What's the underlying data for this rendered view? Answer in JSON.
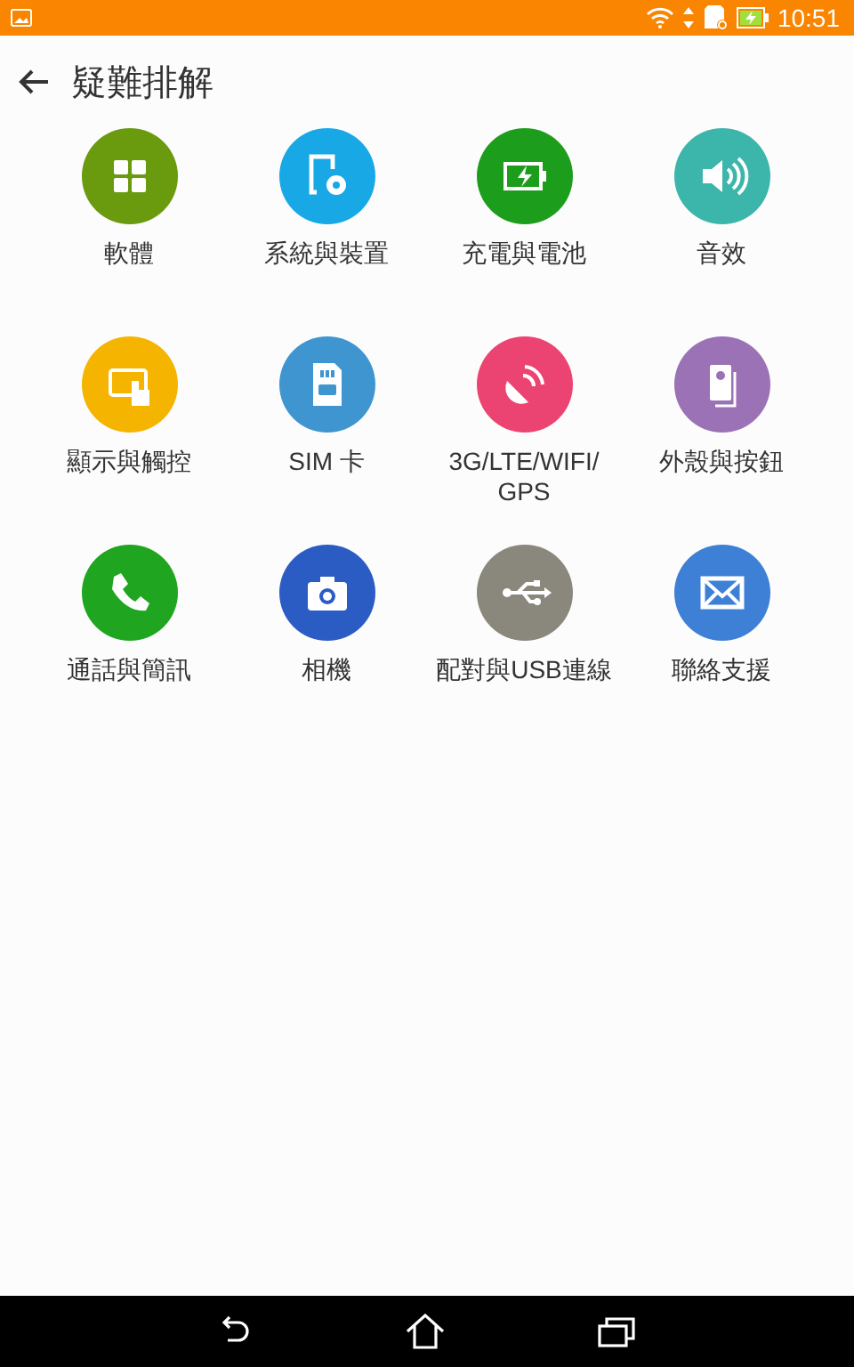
{
  "status_bar": {
    "time": "10:51"
  },
  "toolbar": {
    "title": "疑難排解"
  },
  "categories": [
    {
      "label": "軟體",
      "kind": "apps",
      "color": "#6a9a0e"
    },
    {
      "label": "系統與裝置",
      "kind": "device",
      "color": "#18a8e6"
    },
    {
      "label": "充電與電池",
      "kind": "battery",
      "color": "#1c9e1c"
    },
    {
      "label": "音效",
      "kind": "sound",
      "color": "#3cb5aa"
    },
    {
      "label": "顯示與觸控",
      "kind": "touch",
      "color": "#f4b400"
    },
    {
      "label": "SIM 卡",
      "kind": "sim",
      "color": "#3f95cf"
    },
    {
      "label": "3G/LTE/WIFI/\nGPS",
      "kind": "signal",
      "color": "#ec4472"
    },
    {
      "label": "外殼與按鈕",
      "kind": "case",
      "color": "#9a72b5"
    },
    {
      "label": "通話與簡訊",
      "kind": "phone",
      "color": "#1fa51f"
    },
    {
      "label": "相機",
      "kind": "camera",
      "color": "#2b5cc3"
    },
    {
      "label": "配對與USB連線",
      "kind": "usb",
      "color": "#8a877c"
    },
    {
      "label": "聯絡支援",
      "kind": "mail",
      "color": "#3d80d6"
    }
  ]
}
